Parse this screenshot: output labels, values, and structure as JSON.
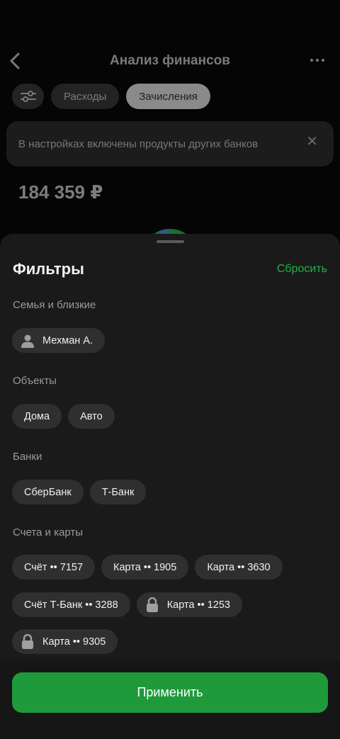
{
  "background": {
    "title": "Анализ финансов",
    "tabs": [
      {
        "label": "Расходы",
        "active": false
      },
      {
        "label": "Зачисления",
        "active": true
      }
    ],
    "notice": "В настройках включены продукты других банков",
    "total": "184 359 ₽"
  },
  "sheet": {
    "title": "Фильтры",
    "reset_label": "Сбросить",
    "sections": {
      "family": {
        "label": "Семья и близкие",
        "chips": [
          {
            "label": "Мехман А.",
            "icon": "person-icon"
          }
        ]
      },
      "objects": {
        "label": "Объекты",
        "chips": [
          {
            "label": "Дома"
          },
          {
            "label": "Авто"
          }
        ]
      },
      "banks": {
        "label": "Банки",
        "chips": [
          {
            "label": "СберБанк"
          },
          {
            "label": "Т-Банк"
          }
        ]
      },
      "accounts": {
        "label": "Счета и карты",
        "chips": [
          {
            "label": "Счёт •• 7157"
          },
          {
            "label": "Карта •• 1905"
          },
          {
            "label": "Карта •• 3630"
          },
          {
            "label": "Счёт Т-Банк •• 3288"
          },
          {
            "label": "Карта •• 1253",
            "icon": "lock-icon"
          },
          {
            "label": "Карта •• 9305",
            "icon": "lock-icon"
          }
        ]
      }
    },
    "apply_label": "Применить"
  },
  "colors": {
    "accent_green": "#1f9a3b",
    "reset_green": "#26b04a",
    "chip_bg": "#2f2f2f",
    "sheet_bg": "#1a1a1a"
  }
}
